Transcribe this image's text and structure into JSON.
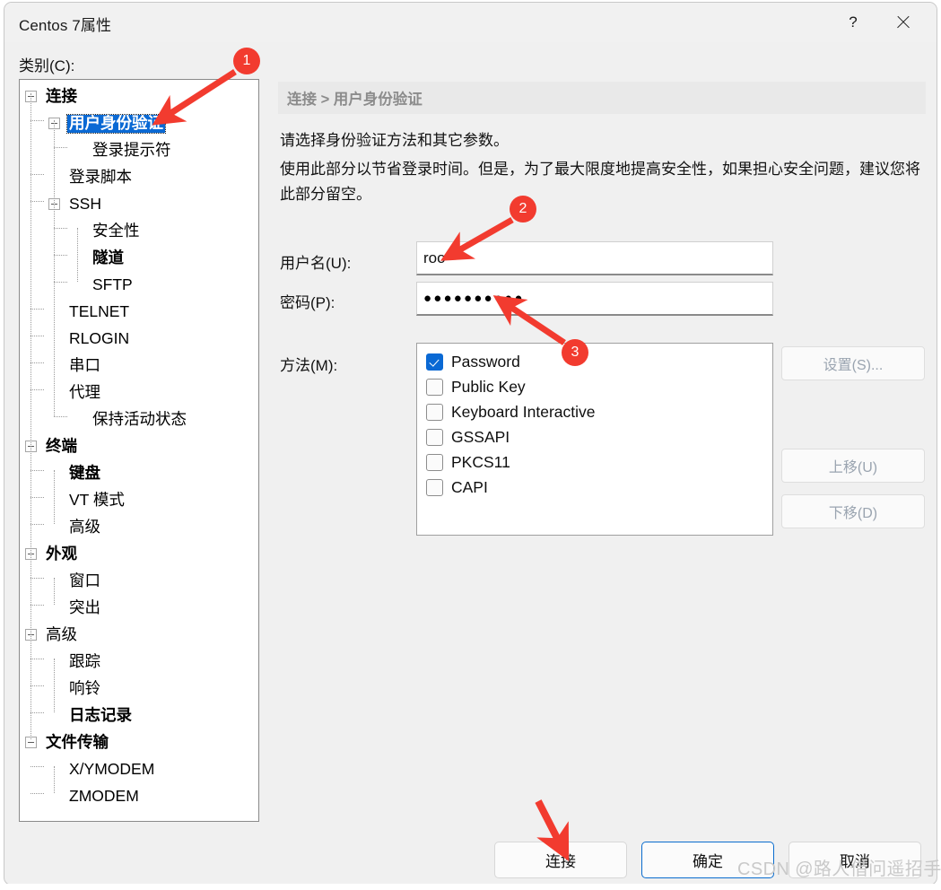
{
  "window": {
    "title": "Centos 7属性",
    "help_icon": "question-mark-icon",
    "close_icon": "close-icon"
  },
  "category": {
    "label": "类别(C):",
    "tree": [
      {
        "label": "连接",
        "level": 0,
        "bold": true,
        "expander": true,
        "selected": false
      },
      {
        "label": "用户身份验证",
        "level": 1,
        "bold": true,
        "expander": true,
        "selected": true
      },
      {
        "label": "登录提示符",
        "level": 2,
        "bold": false,
        "expander": false,
        "selected": false
      },
      {
        "label": "登录脚本",
        "level": 1,
        "bold": false,
        "expander": false,
        "selected": false
      },
      {
        "label": "SSH",
        "level": 1,
        "bold": false,
        "expander": true,
        "selected": false
      },
      {
        "label": "安全性",
        "level": 2,
        "bold": false,
        "expander": false,
        "selected": false
      },
      {
        "label": "隧道",
        "level": 2,
        "bold": true,
        "expander": false,
        "selected": false
      },
      {
        "label": "SFTP",
        "level": 2,
        "bold": false,
        "expander": false,
        "selected": false
      },
      {
        "label": "TELNET",
        "level": 1,
        "bold": false,
        "expander": false,
        "selected": false
      },
      {
        "label": "RLOGIN",
        "level": 1,
        "bold": false,
        "expander": false,
        "selected": false
      },
      {
        "label": "串口",
        "level": 1,
        "bold": false,
        "expander": false,
        "selected": false
      },
      {
        "label": "代理",
        "level": 1,
        "bold": false,
        "expander": false,
        "selected": false
      },
      {
        "label": "保持活动状态",
        "level": 2,
        "bold": false,
        "expander": false,
        "selected": false
      },
      {
        "label": "终端",
        "level": 0,
        "bold": true,
        "expander": true,
        "selected": false
      },
      {
        "label": "键盘",
        "level": 1,
        "bold": true,
        "expander": false,
        "selected": false
      },
      {
        "label": "VT 模式",
        "level": 1,
        "bold": false,
        "expander": false,
        "selected": false
      },
      {
        "label": "高级",
        "level": 1,
        "bold": false,
        "expander": false,
        "selected": false
      },
      {
        "label": "外观",
        "level": 0,
        "bold": true,
        "expander": true,
        "selected": false
      },
      {
        "label": "窗口",
        "level": 1,
        "bold": false,
        "expander": false,
        "selected": false
      },
      {
        "label": "突出",
        "level": 1,
        "bold": false,
        "expander": false,
        "selected": false
      },
      {
        "label": "高级",
        "level": 0,
        "bold": false,
        "expander": true,
        "selected": false
      },
      {
        "label": "跟踪",
        "level": 1,
        "bold": false,
        "expander": false,
        "selected": false
      },
      {
        "label": "响铃",
        "level": 1,
        "bold": false,
        "expander": false,
        "selected": false
      },
      {
        "label": "日志记录",
        "level": 1,
        "bold": true,
        "expander": false,
        "selected": false
      },
      {
        "label": "文件传输",
        "level": 0,
        "bold": true,
        "expander": true,
        "selected": false
      },
      {
        "label": "X/YMODEM",
        "level": 1,
        "bold": false,
        "expander": false,
        "selected": false
      },
      {
        "label": "ZMODEM",
        "level": 1,
        "bold": false,
        "expander": false,
        "selected": false
      }
    ]
  },
  "content": {
    "breadcrumb": "连接 > 用户身份验证",
    "description_line1": "请选择身份验证方法和其它参数。",
    "description_line2": "使用此部分以节省登录时间。但是，为了最大限度地提高安全性，如果担心安全问题，建议您将此部分留空。",
    "username": {
      "label": "用户名(U):",
      "value": "roo"
    },
    "password": {
      "label": "密码(P):",
      "value": "●●●●●●●●●●"
    },
    "methods": {
      "label": "方法(M):",
      "items": [
        {
          "label": "Password",
          "checked": true
        },
        {
          "label": "Public Key",
          "checked": false
        },
        {
          "label": "Keyboard Interactive",
          "checked": false
        },
        {
          "label": "GSSAPI",
          "checked": false
        },
        {
          "label": "PKCS11",
          "checked": false
        },
        {
          "label": "CAPI",
          "checked": false
        }
      ]
    },
    "side_buttons": [
      {
        "label": "设置(S)...",
        "disabled": true
      },
      {
        "label": "上移(U)",
        "disabled": true
      },
      {
        "label": "下移(D)",
        "disabled": true
      }
    ]
  },
  "footer": {
    "buttons": [
      {
        "label": "连接",
        "focused": false
      },
      {
        "label": "确定",
        "focused": true
      },
      {
        "label": "取消",
        "focused": false
      }
    ]
  },
  "annotations": {
    "badges": [
      {
        "number": "1"
      },
      {
        "number": "2"
      },
      {
        "number": "3"
      }
    ],
    "arrow_color": "#f23b2f"
  },
  "watermark": "CSDN @路人借问遥招手"
}
